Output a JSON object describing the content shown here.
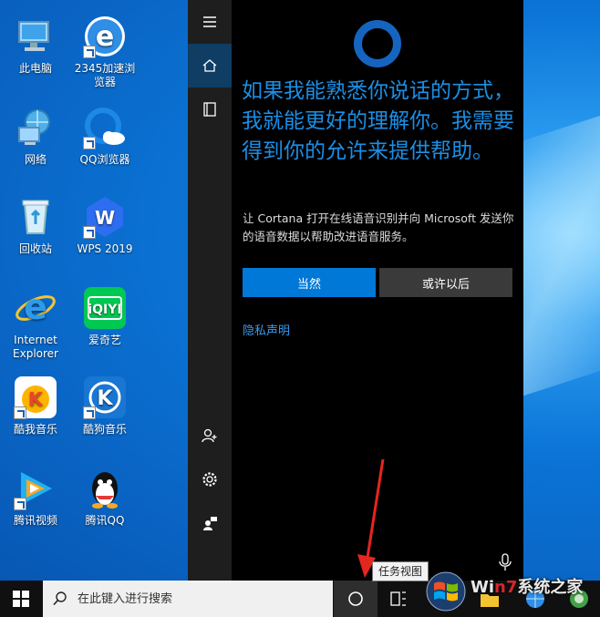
{
  "desktop": {
    "icons": [
      {
        "label": "此电脑",
        "icon": "computer-icon"
      },
      {
        "label": "2345加速浏览器",
        "icon": "browser-2345-icon"
      },
      {
        "label": "网络",
        "icon": "network-icon"
      },
      {
        "label": "QQ浏览器",
        "icon": "qq-browser-icon"
      },
      {
        "label": "回收站",
        "icon": "recycle-bin-icon"
      },
      {
        "label": "WPS 2019",
        "icon": "wps-icon"
      },
      {
        "label": "Internet Explorer",
        "icon": "ie-icon"
      },
      {
        "label": "爱奇艺",
        "icon": "iqiyi-icon"
      },
      {
        "label": "酷我音乐",
        "icon": "kuwo-icon"
      },
      {
        "label": "酷狗音乐",
        "icon": "kugou-icon"
      },
      {
        "label": "腾讯视频",
        "icon": "tencent-video-icon"
      },
      {
        "label": "腾讯QQ",
        "icon": "qq-icon"
      }
    ]
  },
  "cortana": {
    "headline": "如果我能熟悉你说话的方式，我就能更好的理解你。我需要得到你的允许来提供帮助。",
    "description": "让 Cortana 打开在线语音识别并向 Microsoft 发送你的语音数据以帮助改进语音服务。",
    "accept_label": "当然",
    "later_label": "或许以后",
    "privacy_label": "隐私声明",
    "accent_color": "#1b8fe6"
  },
  "taskbar": {
    "search_placeholder": "在此键入进行搜索",
    "tooltip": "任务视图"
  },
  "watermark": {
    "text_white": "Wi",
    "text_red": "n7",
    "text_rest": "系统之家"
  }
}
